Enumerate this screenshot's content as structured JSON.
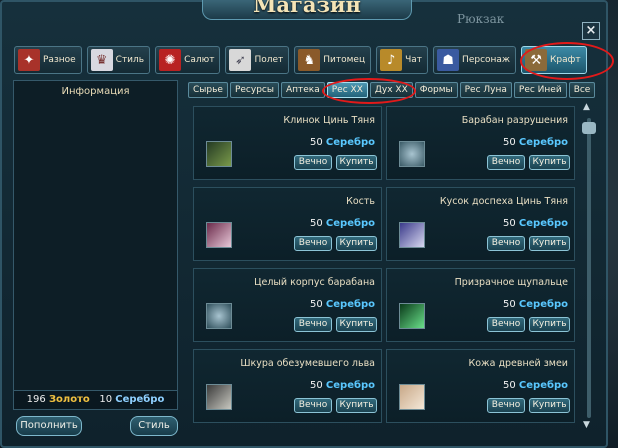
{
  "window": {
    "title": "Магазин",
    "background_title": "Рюкзак",
    "close_label": "×"
  },
  "tabs": [
    {
      "label": "Разное",
      "icon": "gift-icon"
    },
    {
      "label": "Стиль",
      "icon": "outfit-icon"
    },
    {
      "label": "Салют",
      "icon": "firework-icon"
    },
    {
      "label": "Полет",
      "icon": "flight-icon"
    },
    {
      "label": "Питомец",
      "icon": "pet-icon"
    },
    {
      "label": "Чат",
      "icon": "chat-icon"
    },
    {
      "label": "Персонаж",
      "icon": "character-icon"
    },
    {
      "label": "Крафт",
      "icon": "craft-icon",
      "active": true
    }
  ],
  "info": {
    "title": "Информация"
  },
  "money": {
    "gold_amount": "196",
    "gold_label": "Золото",
    "silver_amount": "10",
    "silver_label": "Серебро"
  },
  "buttons": {
    "topup": "Пополнить",
    "style": "Стиль"
  },
  "subtabs": [
    {
      "label": "Сырье"
    },
    {
      "label": "Ресурсы"
    },
    {
      "label": "Аптека"
    },
    {
      "label": "Рес XX",
      "active": true
    },
    {
      "label": "Дух XX"
    },
    {
      "label": "Формы"
    },
    {
      "label": "Рес Луна"
    },
    {
      "label": "Рес Иней"
    },
    {
      "label": "Все"
    }
  ],
  "items": [
    {
      "name": "Клинок Цинь Тяня",
      "price": "50",
      "currency": "Серебро",
      "forever": "Вечно",
      "buy": "Купить",
      "icon": "blade-icon"
    },
    {
      "name": "Барабан разрушения",
      "price": "50",
      "currency": "Серебро",
      "forever": "Вечно",
      "buy": "Купить",
      "icon": "drum-icon"
    },
    {
      "name": "Кость",
      "price": "50",
      "currency": "Серебро",
      "forever": "Вечно",
      "buy": "Купить",
      "icon": "bone-icon"
    },
    {
      "name": "Кусок доспеха Цинь Тяня",
      "price": "50",
      "currency": "Серебро",
      "forever": "Вечно",
      "buy": "Купить",
      "icon": "armor-piece-icon"
    },
    {
      "name": "Целый корпус барабана",
      "price": "50",
      "currency": "Серебро",
      "forever": "Вечно",
      "buy": "Купить",
      "icon": "drum-body-icon"
    },
    {
      "name": "Призрачное щупальце",
      "price": "50",
      "currency": "Серебро",
      "forever": "Вечно",
      "buy": "Купить",
      "icon": "tentacle-icon"
    },
    {
      "name": "Шкура обезумевшего льва",
      "price": "50",
      "currency": "Серебро",
      "forever": "Вечно",
      "buy": "Купить",
      "icon": "lion-hide-icon"
    },
    {
      "name": "Кожа древней змеи",
      "price": "50",
      "currency": "Серебро",
      "forever": "Вечно",
      "buy": "Купить",
      "icon": "snake-skin-icon"
    }
  ],
  "colors": {
    "accent": "#3c8aa6",
    "silver_text": "#5ac8ff",
    "gold_text": "#f0c040",
    "highlight_ring": "#e21a1a"
  }
}
